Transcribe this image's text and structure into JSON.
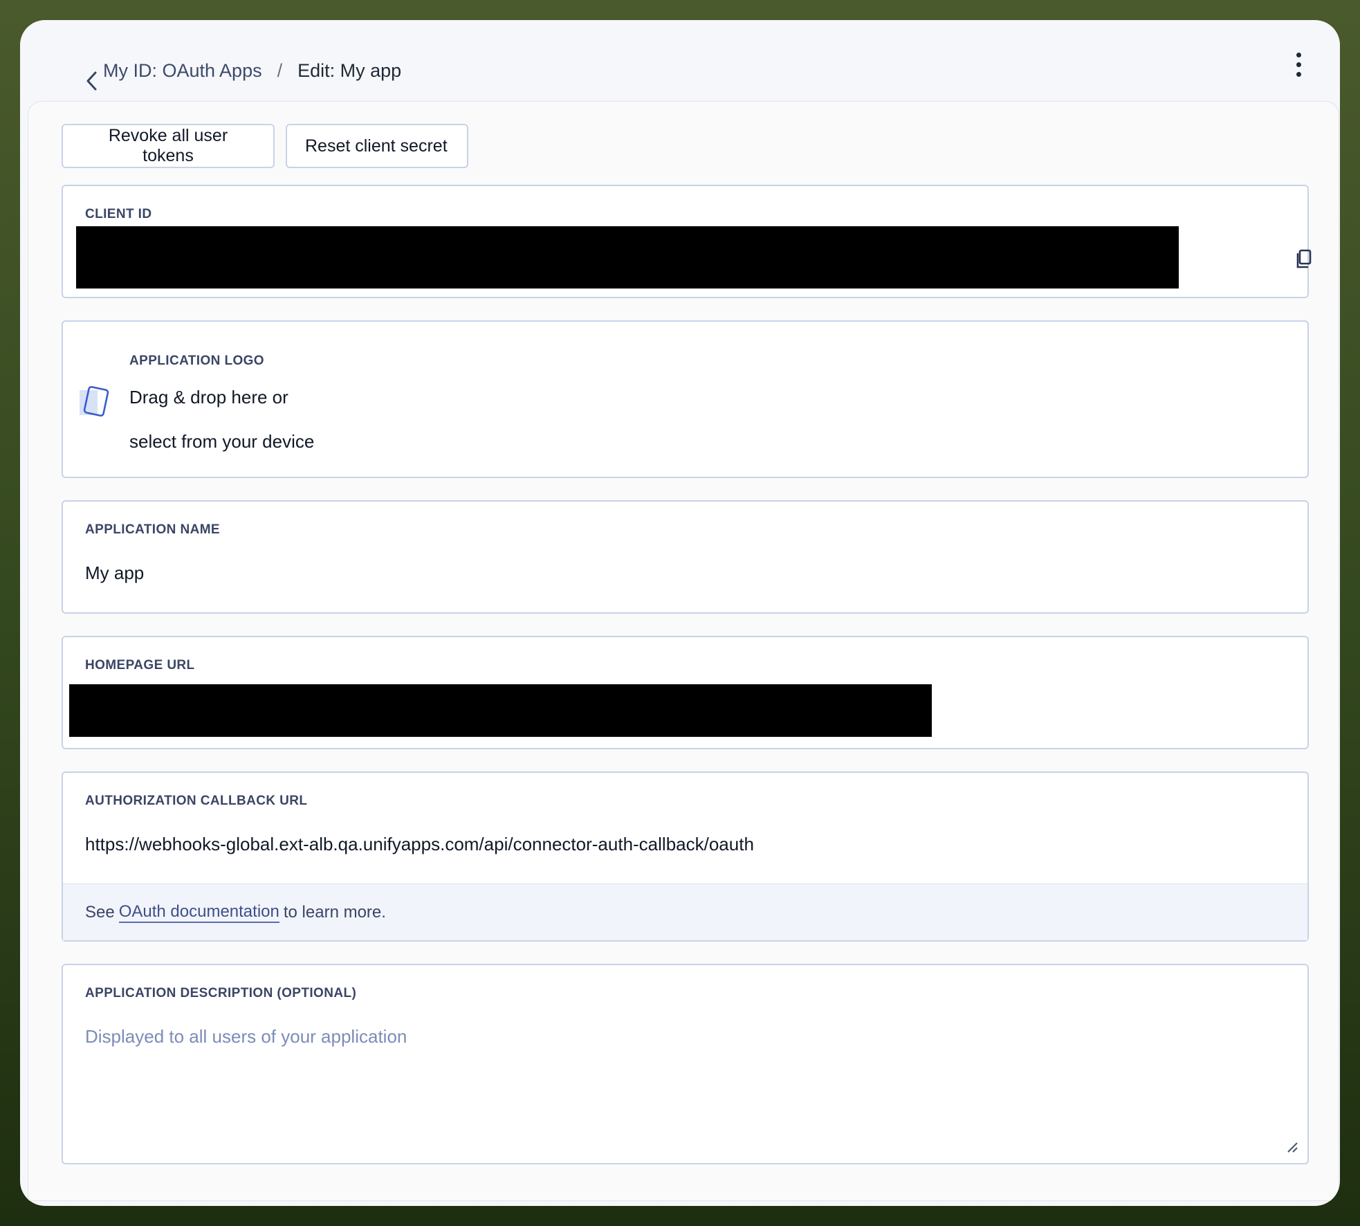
{
  "header": {
    "back_icon": "chevron-left-icon",
    "breadcrumb_parent": "My ID: OAuth Apps",
    "breadcrumb_separator": "/",
    "breadcrumb_current": "Edit: My app",
    "more_icon": "more-vertical-icon"
  },
  "actions": {
    "revoke_label": "Revoke all user tokens",
    "reset_label": "Reset client secret"
  },
  "client_id": {
    "label": "CLIENT ID",
    "copy_icon": "copy-icon"
  },
  "logo": {
    "label": "APPLICATION LOGO",
    "line1": "Drag & drop here or",
    "line2": "select from your device",
    "icon": "image-upload-icon"
  },
  "app_name": {
    "label": "APPLICATION NAME",
    "value": "My app"
  },
  "homepage": {
    "label": "HOMEPAGE URL"
  },
  "callback": {
    "label": "AUTHORIZATION CALLBACK URL",
    "value": "https://webhooks-global.ext-alb.qa.unifyapps.com/api/connector-auth-callback/oauth",
    "help_prefix": "See",
    "help_link": "OAuth documentation",
    "help_suffix": "to learn more."
  },
  "description": {
    "label": "APPLICATION DESCRIPTION (OPTIONAL)",
    "placeholder": "Displayed to all users of your application"
  },
  "colors": {
    "border": "#c8d2e8",
    "accent": "#3d4f8a",
    "placeholder": "#7d8bb8",
    "redaction": "#000000"
  }
}
